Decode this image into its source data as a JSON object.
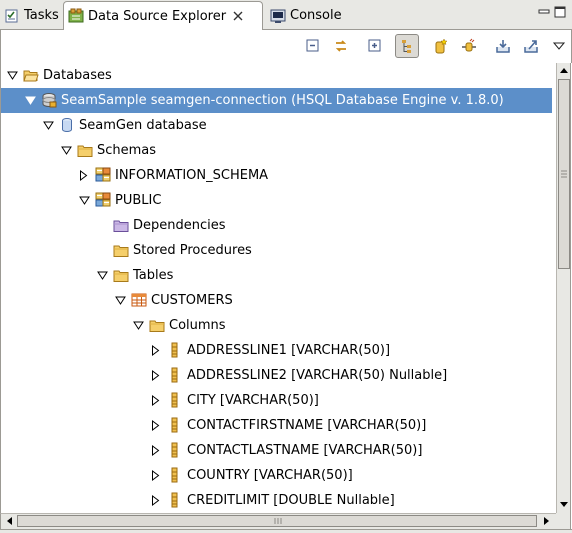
{
  "tabs": [
    {
      "label": "Tasks",
      "icon": "tasks-icon",
      "active": false
    },
    {
      "label": "Data Source Explorer",
      "icon": "data-source-explorer-icon",
      "active": true
    },
    {
      "label": "Console",
      "icon": "console-icon",
      "active": false
    }
  ],
  "toolbar": {
    "buttons": [
      "collapse-all-icon",
      "link-with-editor-icon",
      "expand-icon",
      "tree-view-icon",
      "new-connection-profile-icon",
      "connect-icon",
      "import-icon",
      "export-icon",
      "view-menu-icon"
    ],
    "pressed": "tree-view-icon"
  },
  "tree": [
    {
      "label": "Databases",
      "icon": "folder-open-icon",
      "depth": 0,
      "expanded": true
    },
    {
      "label": "SeamSample seamgen-connection (HSQL Database Engine v. 1.8.0)",
      "icon": "database-connection-icon",
      "depth": 1,
      "expanded": true,
      "selected": true
    },
    {
      "label": "SeamGen database",
      "icon": "database-icon",
      "depth": 2,
      "expanded": true
    },
    {
      "label": "Schemas",
      "icon": "folder-icon",
      "depth": 3,
      "expanded": true
    },
    {
      "label": "INFORMATION_SCHEMA",
      "icon": "schema-icon",
      "depth": 4,
      "expanded": false
    },
    {
      "label": "PUBLIC",
      "icon": "schema-icon",
      "depth": 4,
      "expanded": true
    },
    {
      "label": "Dependencies",
      "icon": "dependencies-folder-icon",
      "depth": 5,
      "leaf": true
    },
    {
      "label": "Stored Procedures",
      "icon": "folder-icon",
      "depth": 5,
      "leaf": true
    },
    {
      "label": "Tables",
      "icon": "folder-icon",
      "depth": 5,
      "expanded": true
    },
    {
      "label": "CUSTOMERS",
      "icon": "table-icon",
      "depth": 6,
      "expanded": true
    },
    {
      "label": "Columns",
      "icon": "folder-icon",
      "depth": 7,
      "expanded": true
    },
    {
      "label": "ADDRESSLINE1 [VARCHAR(50)]",
      "icon": "column-icon",
      "depth": 8,
      "expanded": false
    },
    {
      "label": "ADDRESSLINE2 [VARCHAR(50) Nullable]",
      "icon": "column-icon",
      "depth": 8,
      "expanded": false
    },
    {
      "label": "CITY [VARCHAR(50)]",
      "icon": "column-icon",
      "depth": 8,
      "expanded": false
    },
    {
      "label": "CONTACTFIRSTNAME [VARCHAR(50)]",
      "icon": "column-icon",
      "depth": 8,
      "expanded": false
    },
    {
      "label": "CONTACTLASTNAME [VARCHAR(50)]",
      "icon": "column-icon",
      "depth": 8,
      "expanded": false
    },
    {
      "label": "COUNTRY [VARCHAR(50)]",
      "icon": "column-icon",
      "depth": 8,
      "expanded": false
    },
    {
      "label": "CREDITLIMIT [DOUBLE Nullable]",
      "icon": "column-icon",
      "depth": 8,
      "expanded": false
    }
  ],
  "colors": {
    "selection": "#5c8fc9",
    "folder": "#f0c050",
    "tabbar": "#e8e8e4"
  }
}
